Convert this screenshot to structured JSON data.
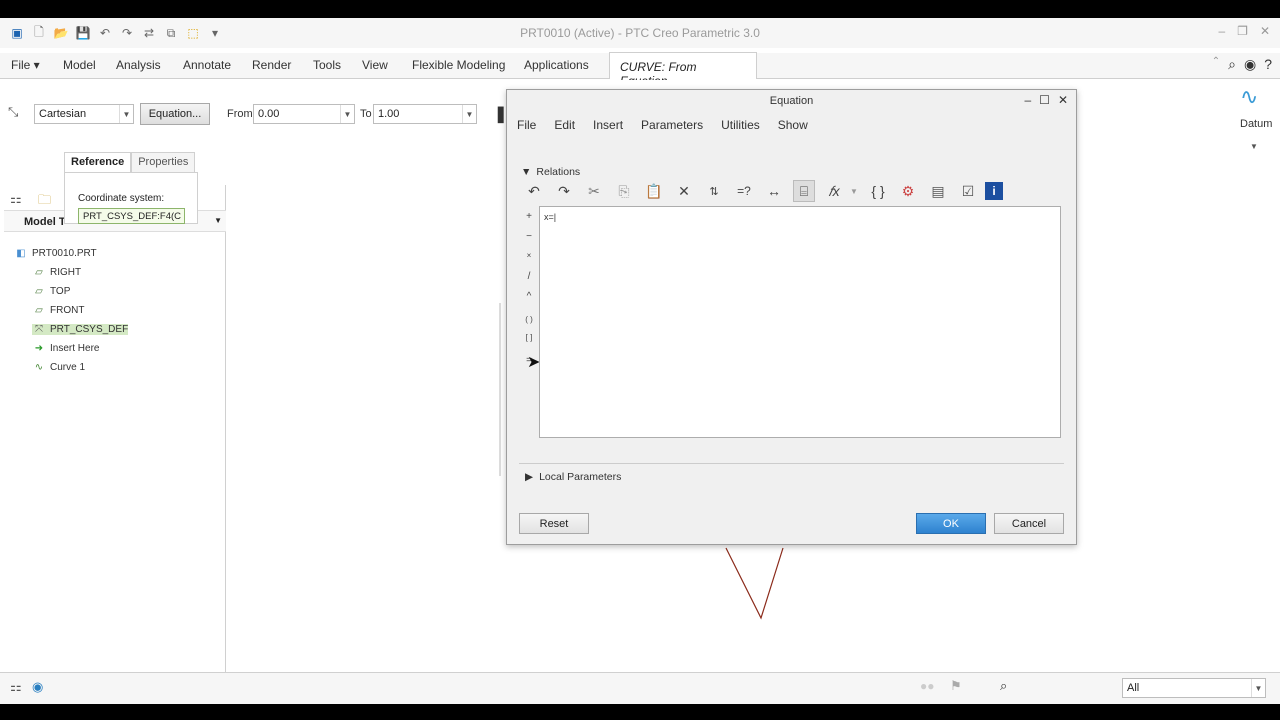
{
  "app": {
    "title": "PRT0010 (Active) - PTC Creo Parametric 3.0"
  },
  "menubar": {
    "file": "File",
    "tabs": [
      "Model",
      "Analysis",
      "Annotate",
      "Render",
      "Tools",
      "View",
      "Flexible Modeling",
      "Applications"
    ],
    "active_tab": "CURVE: From Equation"
  },
  "ribbon": {
    "coord_type": "Cartesian",
    "equation_button": "Equation...",
    "from_label": "From",
    "from_value": "0.00",
    "to_label": "To",
    "to_value": "1.00",
    "datum_label": "Datum"
  },
  "subtabs": {
    "reference": "Reference",
    "properties": "Properties"
  },
  "reference_panel": {
    "label": "Coordinate system:",
    "value": "PRT_CSYS_DEF:F4(C"
  },
  "model_tree": {
    "header": "Model T",
    "items": [
      {
        "label": "PRT0010.PRT",
        "icon": "part-icon"
      },
      {
        "label": "RIGHT",
        "icon": "datum-plane-icon"
      },
      {
        "label": "TOP",
        "icon": "datum-plane-icon"
      },
      {
        "label": "FRONT",
        "icon": "datum-plane-icon"
      },
      {
        "label": "PRT_CSYS_DEF",
        "icon": "csys-icon"
      },
      {
        "label": "Insert Here",
        "icon": "insert-arrow-icon"
      },
      {
        "label": "Curve 1",
        "icon": "curve-icon"
      }
    ]
  },
  "dialog": {
    "title": "Equation",
    "menu": [
      "File",
      "Edit",
      "Insert",
      "Parameters",
      "Utilities",
      "Show"
    ],
    "relations_label": "Relations",
    "editor_text": "x=|",
    "operators": [
      "+",
      "−",
      "×",
      "/",
      "^",
      "( )",
      "[ ]",
      "="
    ],
    "local_parameters": "Local Parameters",
    "reset": "Reset",
    "ok": "OK",
    "cancel": "Cancel"
  },
  "statusbar": {
    "filter": "All"
  },
  "colors": {
    "accent": "#2e82cf",
    "curve": "#8b2a1a",
    "highlight": "#d4e9c4"
  }
}
